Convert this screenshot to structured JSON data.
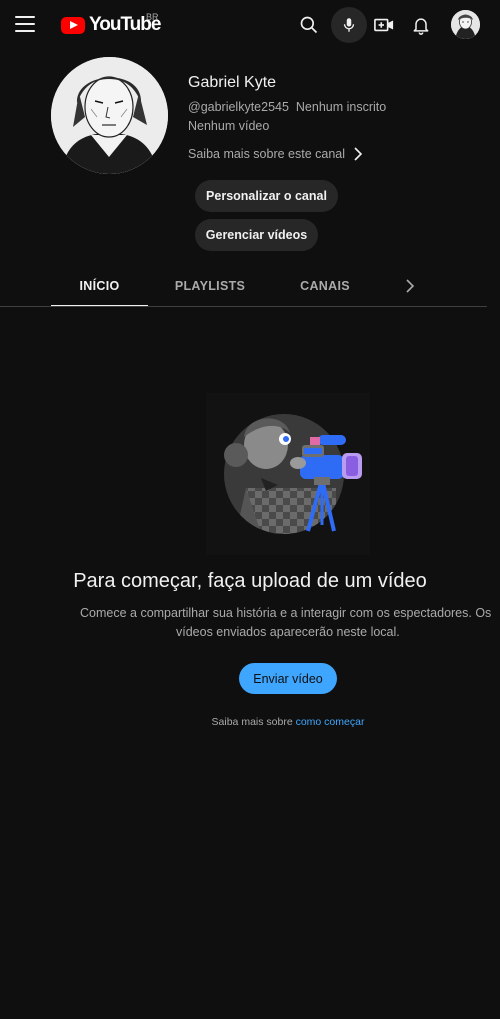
{
  "topbar": {
    "logo_text": "YouTube",
    "country_code": "BR",
    "icons": [
      "menu-icon",
      "search-icon",
      "mic-icon",
      "create-video-icon",
      "notifications-bell-icon",
      "account-avatar"
    ]
  },
  "channel": {
    "name": "Gabriel Kyte",
    "handle": "@gabrielkyte2545",
    "subscribers": "Nenhum inscrito",
    "videos": "Nenhum vídeo",
    "more_about": "Saiba mais sobre este canal",
    "customize_label": "Personalizar o canal",
    "manage_label": "Gerenciar vídeos"
  },
  "tabs": [
    {
      "label": "INÍCIO",
      "active": true
    },
    {
      "label": "PLAYLISTS",
      "active": false
    },
    {
      "label": "CANAIS",
      "active": false
    }
  ],
  "empty_state": {
    "title": "Para começar, faça upload de um vídeo",
    "description_line1": "Comece a compartilhar sua história e a interagir com os espectadores. Os",
    "description_line2": "vídeos enviados aparecerão neste local.",
    "upload_label": "Enviar vídeo",
    "learn_prefix": "Saiba mais sobre ",
    "learn_link": "como começar"
  },
  "colors": {
    "background": "#0f0f0f",
    "accent_blue": "#3ea6ff",
    "logo_red": "#ff0000",
    "pill_bg": "#272727"
  }
}
